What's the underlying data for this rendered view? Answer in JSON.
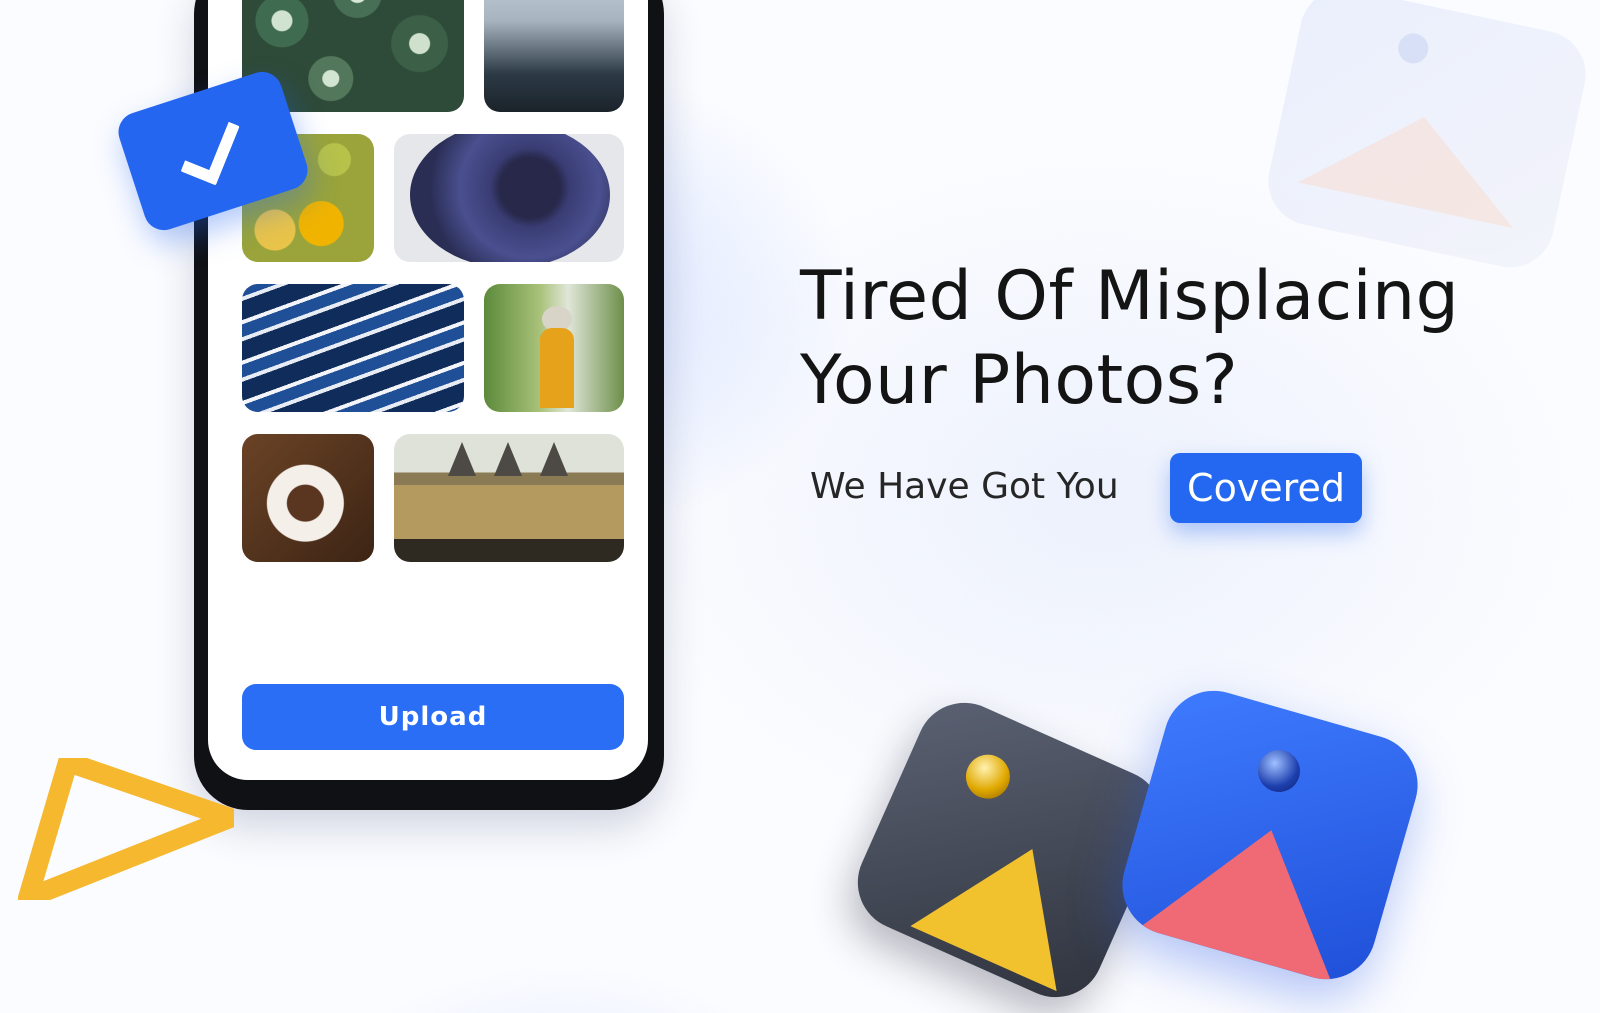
{
  "headline": {
    "line1": "Tired Of Misplacing",
    "line2": "Your Photos?"
  },
  "tagline": {
    "text": "We Have Got You",
    "highlight": "Covered"
  },
  "phone": {
    "upload_label": "Upload",
    "photos": [
      {
        "name": "cactus"
      },
      {
        "name": "steam-train"
      },
      {
        "name": "grapes"
      },
      {
        "name": "portal"
      },
      {
        "name": "boats"
      },
      {
        "name": "woman"
      },
      {
        "name": "coffee"
      },
      {
        "name": "castle"
      }
    ]
  },
  "colors": {
    "accent": "#2a6ef5",
    "text": "#141414",
    "triangle": "#f5b82e"
  },
  "icons": [
    "check-icon",
    "triangle-icon",
    "gallery-icon-dark",
    "gallery-icon-blue",
    "gallery-icon-faded"
  ]
}
